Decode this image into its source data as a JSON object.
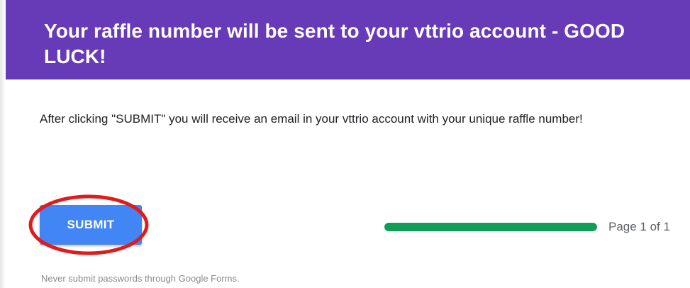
{
  "header": {
    "title": "Your raffle number will be sent to your vttrio account - GOOD LUCK!",
    "background_color": "#673ab7"
  },
  "description": "After clicking \"SUBMIT\" you will receive an email in your vttrio account with your unique raffle number!",
  "submit_button": {
    "label": "SUBMIT",
    "color": "#4285f4",
    "highlight_color": "#e01b1b"
  },
  "progress": {
    "fraction": 1.0,
    "fill_color": "#0f9d58",
    "page_label": "Page 1 of 1"
  },
  "footer": {
    "note": "Never submit passwords through Google Forms."
  }
}
